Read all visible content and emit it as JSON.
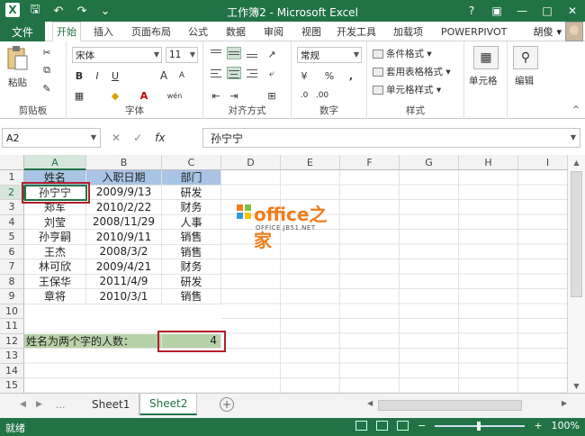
{
  "window": {
    "title": "工作簿2 - Microsoft Excel",
    "buttons": {
      "help": "?",
      "ribbon_opts": "▣",
      "minimize": "—",
      "maximize": "□",
      "close": "✕"
    }
  },
  "qat": {
    "logo": "X",
    "save": "🖫",
    "undo": "↶",
    "redo": "↷",
    "more": "⌄"
  },
  "tabs": {
    "file": "文件",
    "items": [
      "开始",
      "插入",
      "页面布局",
      "公式",
      "数据",
      "审阅",
      "视图",
      "开发工具",
      "加载项",
      "POWERPIVOT"
    ],
    "active": "开始"
  },
  "user": {
    "name": "胡俊",
    "dropdown": "▾"
  },
  "ribbon": {
    "clipboard": {
      "label": "剪贴板",
      "paste": "粘贴"
    },
    "font": {
      "label": "字体",
      "name": "宋体",
      "size": "11",
      "bold": "B",
      "italic": "I",
      "underline": "U",
      "grow": "A",
      "shrink": "A",
      "wen": "wén"
    },
    "alignment": {
      "label": "对齐方式"
    },
    "number": {
      "label": "数字",
      "format": "常规",
      "percent": "%",
      "comma": ","
    },
    "styles": {
      "label": "样式",
      "conditional": "条件格式",
      "table": "套用表格格式",
      "cell": "单元格样式"
    },
    "cells": {
      "label": "单元格"
    },
    "editing": {
      "label": "编辑"
    }
  },
  "formula_bar": {
    "name_box": "A2",
    "cancel": "✕",
    "enter": "✓",
    "fx": "fx",
    "content": "孙宁宁"
  },
  "sheet": {
    "columns": [
      "A",
      "B",
      "C",
      "D",
      "E",
      "F",
      "G",
      "H",
      "I"
    ],
    "rows": [
      "1",
      "2",
      "3",
      "4",
      "5",
      "6",
      "7",
      "8",
      "9",
      "10",
      "11",
      "12",
      "13",
      "14",
      "15"
    ],
    "header": {
      "name": "姓名",
      "date": "入职日期",
      "dept": "部门"
    },
    "records": [
      {
        "name": "孙宁宁",
        "date": "2009/9/13",
        "dept": "研发"
      },
      {
        "name": "郑军",
        "date": "2010/2/22",
        "dept": "财务"
      },
      {
        "name": "刘莹",
        "date": "2008/11/29",
        "dept": "人事"
      },
      {
        "name": "孙亨嗣",
        "date": "2010/9/11",
        "dept": "销售"
      },
      {
        "name": "王杰",
        "date": "2008/3/2",
        "dept": "销售"
      },
      {
        "name": "林可欣",
        "date": "2009/4/21",
        "dept": "财务"
      },
      {
        "name": "王保华",
        "date": "2011/4/9",
        "dept": "研发"
      },
      {
        "name": "章将",
        "date": "2010/3/1",
        "dept": "销售"
      }
    ],
    "summary_label": "姓名为两个字的人数：",
    "summary_value": "4"
  },
  "watermark": {
    "brand": "office之家",
    "url": "OFFICE.JB51.NET"
  },
  "sheet_tabs": {
    "tabs": [
      "Sheet1",
      "Sheet2"
    ],
    "active": "Sheet2",
    "add": "+",
    "prev": "◀",
    "next": "▶",
    "dots": "..."
  },
  "status": {
    "ready": "就绪",
    "zoom": "100%",
    "zoom_minus": "−",
    "zoom_plus": "+"
  },
  "colors": {
    "excel_green": "#217346",
    "header_fill": "#a9c4e4",
    "summary_fill": "#b7d2a8",
    "highlight": "#b4202a"
  }
}
